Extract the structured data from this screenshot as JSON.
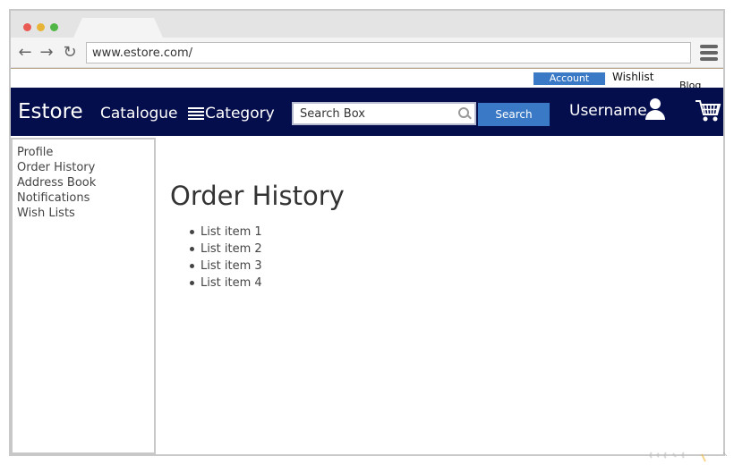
{
  "browser": {
    "url": "www.estore.com/"
  },
  "topbar": {
    "account_label": "Account",
    "wishlist_label": "Wishlist",
    "blog_label": "Blog"
  },
  "navbar": {
    "brand": "Estore",
    "catalogue_label": "Catalogue",
    "category_label": "Category",
    "search_placeholder": "Search Box",
    "search_button": "Search",
    "username": "Username"
  },
  "sidebar": {
    "items": [
      {
        "label": "Profile"
      },
      {
        "label": "Order History"
      },
      {
        "label": "Address Book"
      },
      {
        "label": "Notifications"
      },
      {
        "label": "Wish Lists"
      }
    ]
  },
  "main": {
    "title": "Order History",
    "list": [
      "List item 1",
      "List item 2",
      "List item 3",
      "List item 4"
    ]
  },
  "colors": {
    "navbar_bg": "#050e4c",
    "accent_button": "#3a79c6"
  }
}
